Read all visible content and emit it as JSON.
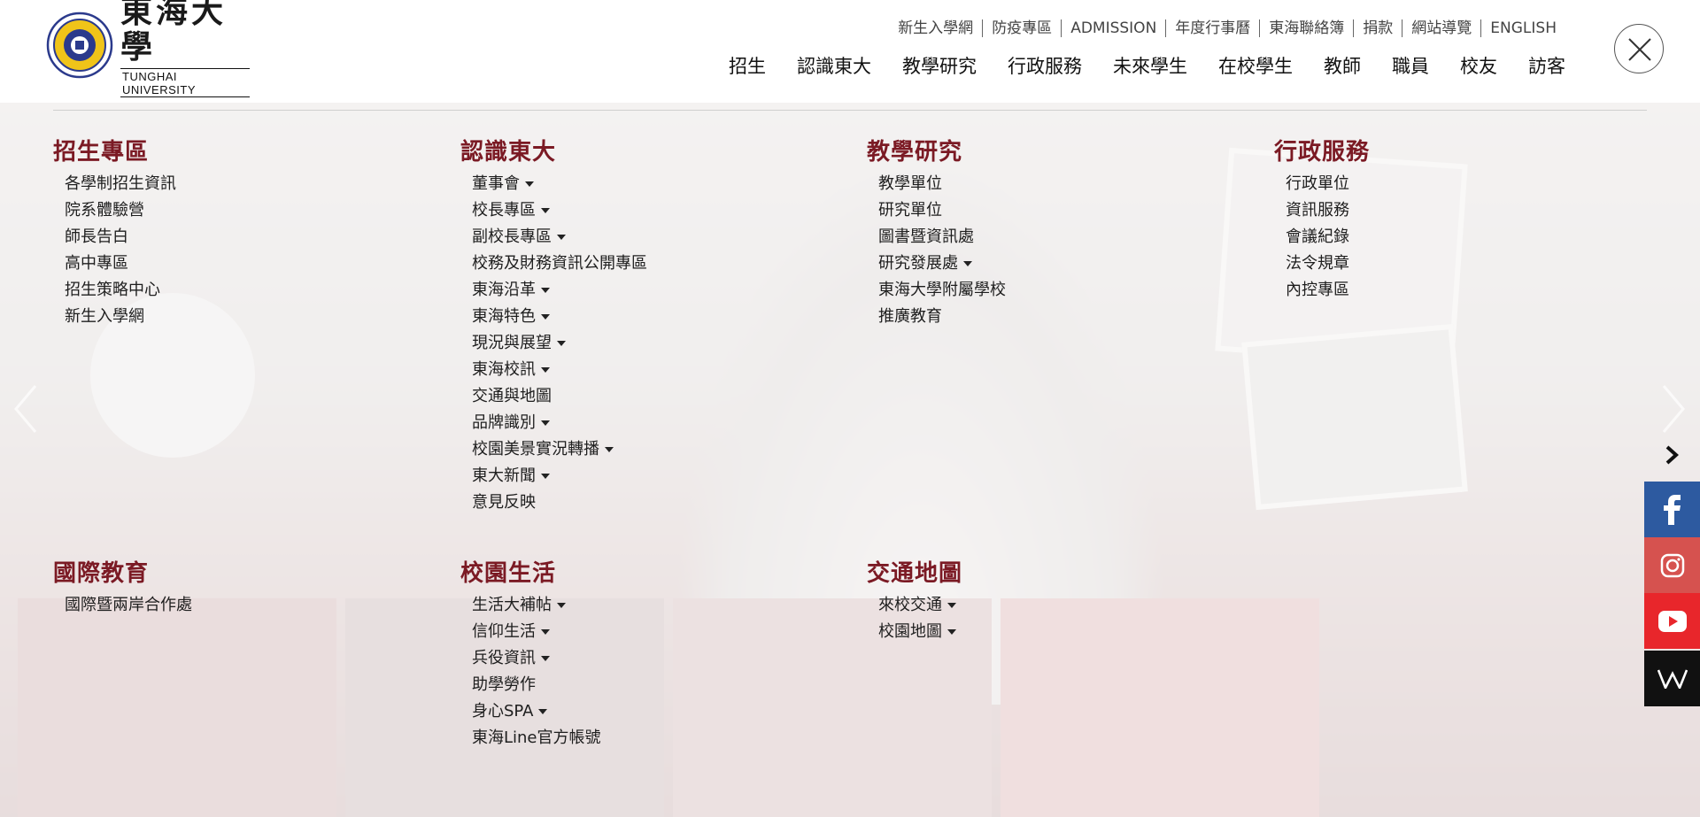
{
  "logo": {
    "name_cn": "東海大學",
    "name_en": "TUNGHAI UNIVERSITY",
    "seal_text": "TUNGHAI UNIVERSITY"
  },
  "top_links": [
    "新生入學網",
    "防疫專區",
    "ADMISSION",
    "年度行事曆",
    "東海聯絡簿",
    "捐款",
    "網站導覽",
    "ENGLISH"
  ],
  "main_nav": [
    "招生",
    "認識東大",
    "教學研究",
    "行政服務",
    "未來學生",
    "在校學生",
    "教師",
    "職員",
    "校友",
    "訪客"
  ],
  "menu": {
    "admissions": {
      "title": "招生專區",
      "items": [
        {
          "label": "各學制招生資訊",
          "caret": false
        },
        {
          "label": "院系體驗營",
          "caret": false
        },
        {
          "label": "師長告白",
          "caret": false
        },
        {
          "label": "高中專區",
          "caret": false
        },
        {
          "label": "招生策略中心",
          "caret": false
        },
        {
          "label": "新生入學網",
          "caret": false
        }
      ]
    },
    "about": {
      "title": "認識東大",
      "items": [
        {
          "label": "董事會",
          "caret": true
        },
        {
          "label": "校長專區",
          "caret": true
        },
        {
          "label": "副校長專區",
          "caret": true
        },
        {
          "label": "校務及財務資訊公開專區",
          "caret": false
        },
        {
          "label": "東海沿革",
          "caret": true
        },
        {
          "label": "東海特色",
          "caret": true
        },
        {
          "label": "現況與展望",
          "caret": true
        },
        {
          "label": "東海校訊",
          "caret": true
        },
        {
          "label": "交通與地圖",
          "caret": false
        },
        {
          "label": "品牌識別",
          "caret": true
        },
        {
          "label": "校園美景實況轉播",
          "caret": true
        },
        {
          "label": "東大新聞",
          "caret": true
        },
        {
          "label": "意見反映",
          "caret": false
        }
      ]
    },
    "teaching": {
      "title": "教學研究",
      "items": [
        {
          "label": "教學單位",
          "caret": false
        },
        {
          "label": "研究單位",
          "caret": false
        },
        {
          "label": "圖書暨資訊處",
          "caret": false
        },
        {
          "label": "研究發展處",
          "caret": true
        },
        {
          "label": "東海大學附屬學校",
          "caret": false
        },
        {
          "label": "推廣教育",
          "caret": false
        }
      ]
    },
    "admin": {
      "title": "行政服務",
      "items": [
        {
          "label": "行政單位",
          "caret": false
        },
        {
          "label": "資訊服務",
          "caret": false
        },
        {
          "label": "會議紀錄",
          "caret": false
        },
        {
          "label": "法令規章",
          "caret": false
        },
        {
          "label": "內控專區",
          "caret": false
        }
      ]
    },
    "international": {
      "title": "國際教育",
      "items": [
        {
          "label": "國際暨兩岸合作處",
          "caret": false
        }
      ]
    },
    "campus": {
      "title": "校園生活",
      "items": [
        {
          "label": "生活大補帖",
          "caret": true
        },
        {
          "label": "信仰生活",
          "caret": true
        },
        {
          "label": "兵役資訊",
          "caret": true
        },
        {
          "label": "助學勞作",
          "caret": false
        },
        {
          "label": "身心SPA",
          "caret": true
        },
        {
          "label": "東海Line官方帳號",
          "caret": false
        }
      ]
    },
    "transport": {
      "title": "交通地圖",
      "items": [
        {
          "label": "來校交通",
          "caret": true
        },
        {
          "label": "校園地圖",
          "caret": true
        }
      ]
    }
  },
  "icons": {
    "close": "close-icon",
    "prev": "chevron-left-icon",
    "next": "chevron-right-icon",
    "social": [
      "facebook-icon",
      "instagram-icon",
      "youtube-icon",
      "wikipedia-icon"
    ]
  },
  "colors": {
    "accent": "#7b1a24",
    "facebook": "#2d5aa0",
    "instagram": "#d6524f",
    "youtube": "#e8262b",
    "wikipedia": "#111111"
  }
}
